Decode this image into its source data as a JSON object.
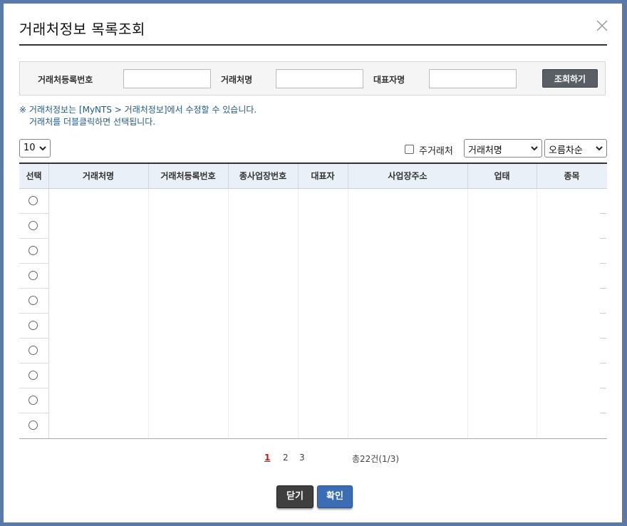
{
  "dialog": {
    "title": "거래처정보 목록조회"
  },
  "search": {
    "reg_no_label": "거래처등록번호",
    "reg_no_value": "",
    "name_label": "거래처명",
    "name_value": "",
    "rep_label": "대표자명",
    "rep_value": "",
    "search_button": "조회하기"
  },
  "notice": {
    "line1": "※ 거래처정보는 [MyNTS > 거래처정보]에서 수정할 수 있습니다.",
    "line2": "거래처를 더블클릭하면 선택됩니다."
  },
  "controls": {
    "page_size": "10",
    "main_partner_label": "주거래처",
    "main_partner_checked": false,
    "sort_field": "거래처명",
    "sort_order": "오름차순"
  },
  "grid": {
    "columns": [
      "선택",
      "거래처명",
      "거래처등록번호",
      "종사업장번호",
      "대표자",
      "사업장주소",
      "업태",
      "종목"
    ],
    "row_count": 10
  },
  "pagination": {
    "pages": [
      "1",
      "2",
      "3"
    ],
    "current": "1",
    "total": "총22건(1/3)"
  },
  "footer": {
    "close_label": "닫기",
    "ok_label": "확인"
  },
  "colors": {
    "search_button": "#5a5f66",
    "ok_button": "#3a6db3",
    "close_button": "#3f3f3f",
    "notice_text": "#1f5b8a",
    "active_page": "#c21a1a",
    "header_bg": "#eaf0f8"
  }
}
